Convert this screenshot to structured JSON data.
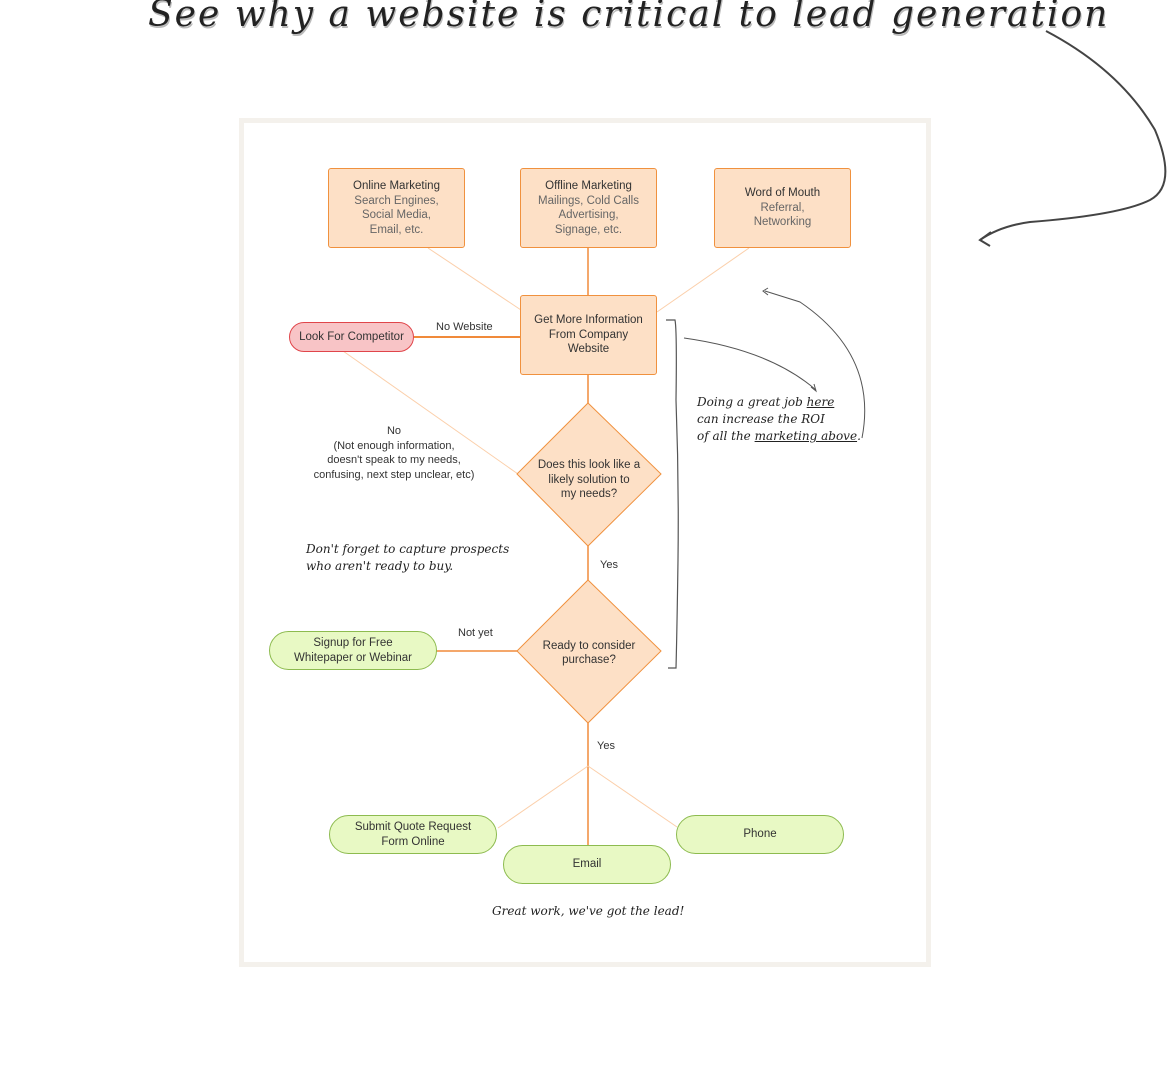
{
  "headline": "See why a website is critical to lead generation",
  "colors": {
    "box_fill": "#fde0c6",
    "box_border": "#f0913e",
    "red_fill": "#f8c4c6",
    "red_border": "#e0454a",
    "green_fill": "#e8f9c4",
    "green_border": "#8dbb4f",
    "frame": "#f4f1ec"
  },
  "sources": [
    {
      "title": "Online Marketing",
      "lines": [
        "Search Engines,",
        "Social Media,",
        "Email, etc."
      ]
    },
    {
      "title": "Offline Marketing",
      "lines": [
        "Mailings, Cold Calls",
        "Advertising,",
        "Signage, etc."
      ]
    },
    {
      "title": "Word of Mouth",
      "lines": [
        "Referral,",
        "Networking"
      ]
    }
  ],
  "website_node": {
    "lines": [
      "Get More Information",
      "From Company",
      "Website"
    ]
  },
  "competitor_node": "Look For Competitor",
  "no_website_label": "No Website",
  "decision1": {
    "lines": [
      "Does this look like a",
      "likely solution to",
      "my needs?"
    ]
  },
  "no_label": {
    "lines": [
      "No",
      "(Not enough information,",
      "doesn't speak to my needs,",
      "confusing, next step unclear, etc)"
    ]
  },
  "yes1_label": "Yes",
  "decision2": {
    "lines": [
      "Ready to consider",
      "purchase?"
    ]
  },
  "not_yet_label": "Not yet",
  "signup_node": {
    "lines": [
      "Signup for Free",
      "Whitepaper or Webinar"
    ]
  },
  "yes2_label": "Yes",
  "outcomes": [
    {
      "lines": [
        "Submit Quote Request",
        "Form Online"
      ]
    },
    {
      "lines": [
        "Email"
      ]
    },
    {
      "lines": [
        "Phone"
      ]
    }
  ],
  "notes": {
    "roi": {
      "line1_a": "Doing a great job ",
      "line1_b": "here",
      "line2": "can increase the ROI",
      "line3_a": "of all the ",
      "line3_b": "marketing above",
      "line3_c": "."
    },
    "capture": [
      "Don't forget to capture prospects",
      "who aren't ready to buy."
    ],
    "lead": "Great work, we've got the lead!"
  }
}
